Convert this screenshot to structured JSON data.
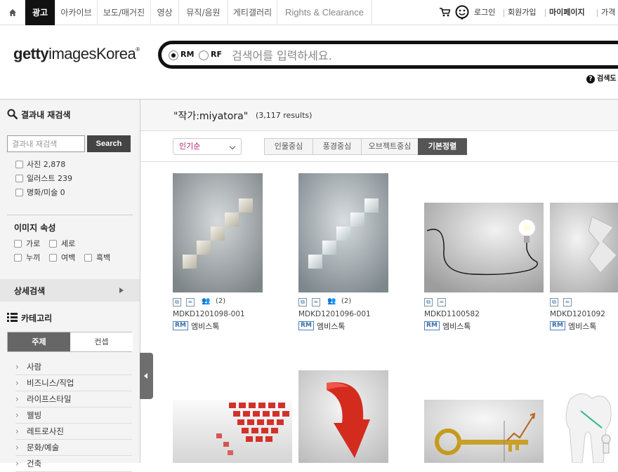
{
  "topnav": {
    "home_icon": "home-icon",
    "tabs": [
      "광고",
      "아카이브",
      "보도/매거진",
      "영상",
      "뮤직/음원",
      "게티갤러리",
      "Rights & Clearance"
    ],
    "active_tab": "광고",
    "util": {
      "login": "로그인",
      "signup": "회원가입",
      "mypage": "마이페이지",
      "price": "가격"
    }
  },
  "header": {
    "logo_text": "gettyimagesKorea",
    "logo_bold": "getty",
    "logo_rest": "imagesKorea",
    "logo_mark": "®",
    "search": {
      "rm_label": "RM",
      "rf_label": "RF",
      "placeholder": "검색어를 입력하세요."
    },
    "help_label": "검색도"
  },
  "sidebar": {
    "refine_title": "결과내 재검색",
    "refine_placeholder": "결과내 재검색",
    "refine_button": "Search",
    "types": [
      {
        "label": "사진 2,878"
      },
      {
        "label": "일러스트 239"
      },
      {
        "label": "명화/미술 0"
      }
    ],
    "props_title": "이미지 속성",
    "props": [
      "가로",
      "세로",
      "누끼",
      "여백",
      "흑백"
    ],
    "advanced_label": "상세검색",
    "category_title": "카테고리",
    "category_tabs": [
      "주제",
      "컨셉"
    ],
    "categories": [
      "사람",
      "비즈니스/직업",
      "라이프스타일",
      "웰빙",
      "레트로사진",
      "문화/예술",
      "건축"
    ]
  },
  "main": {
    "results_title": "\"작가:miyatora\"",
    "results_count": "(3,117 results)",
    "sort_value": "인기순",
    "view_tabs": [
      "인물중심",
      "풍경중심",
      "오브젝트중심",
      "기본정렬"
    ],
    "active_view": "기본정렬",
    "images": [
      {
        "id": "MDKD1201098-001",
        "badge": "RM",
        "provider": "엠비스톡",
        "release": "(2)"
      },
      {
        "id": "MDKD1201096-001",
        "badge": "RM",
        "provider": "엠비스톡",
        "release": "(2)"
      },
      {
        "id": "MDKD1100582",
        "badge": "RM",
        "provider": "엠비스톡",
        "release": ""
      },
      {
        "id": "MDKD1201092",
        "badge": "RM",
        "provider": "엠비스톡",
        "release": ""
      }
    ]
  }
}
